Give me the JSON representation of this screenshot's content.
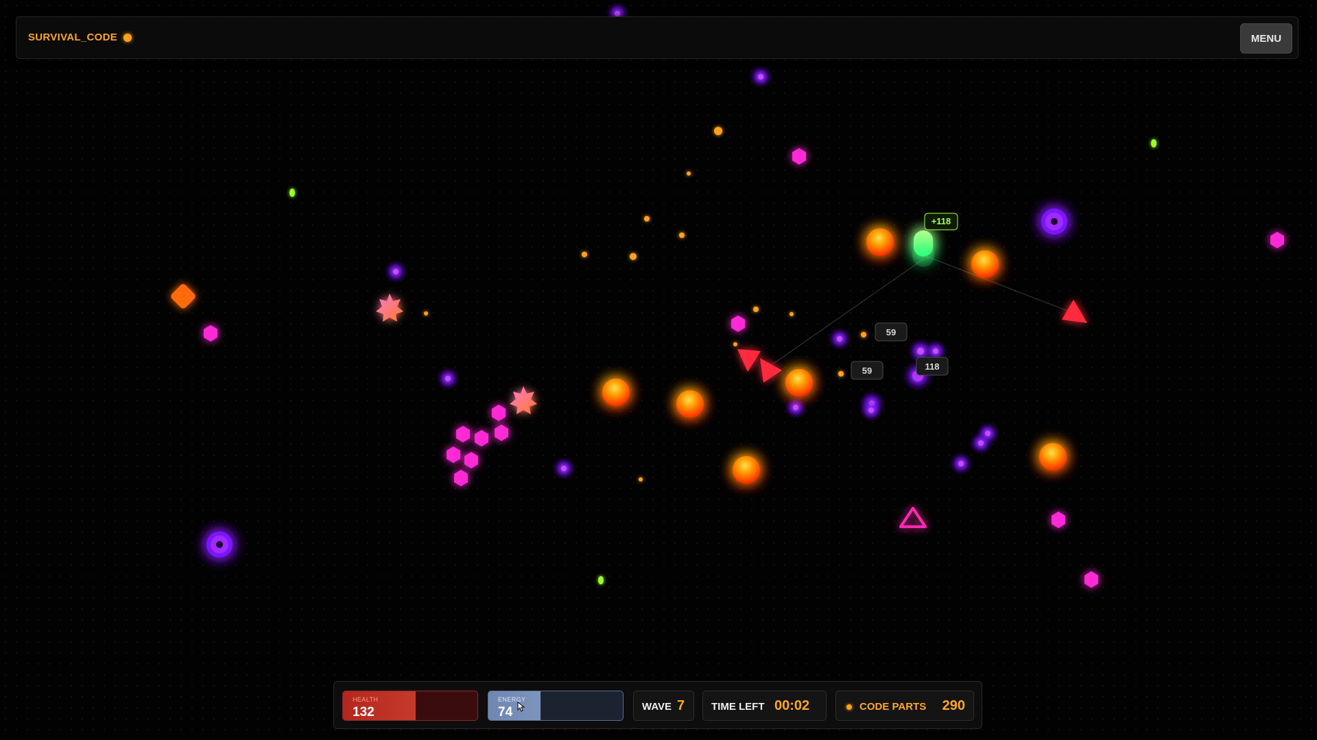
{
  "header": {
    "brand": "SURVIVAL_CODE",
    "menu_label": "MENU"
  },
  "hud": {
    "health": {
      "label": "HEALTH",
      "value": "132",
      "fill_fraction": 0.54
    },
    "energy": {
      "label": "ENERGY",
      "value": "74",
      "fill_fraction": 0.39
    },
    "wave": {
      "label": "WAVE",
      "value": "7"
    },
    "time_left": {
      "label": "TIME LEFT",
      "value": "00:02"
    },
    "code_parts": {
      "label": "CODE PARTS",
      "value": "290"
    }
  },
  "floating_labels": {
    "pickup_gain": "+118",
    "enemy_hp_a": "59",
    "enemy_hp_b": "59",
    "enemy_hp_c": "118"
  },
  "colors": {
    "accent": "#ffa726",
    "player": "#7dff7a",
    "enemy_magenta": "#ff2bd6",
    "enemy_red": "#ff2a3c",
    "enemy_orange": "#ff6a00",
    "enemy_violet": "#8a1cff",
    "health": "#b3261e",
    "energy": "#6e86b0"
  },
  "icons": {
    "player": "player-capsule-icon",
    "code_part": "code-part-dot-icon",
    "fireball": "fireball-enemy-icon",
    "hexagon": "hexagon-enemy-icon",
    "triangle": "triangle-enemy-icon",
    "portal": "portal-enemy-icon",
    "spiky": "spiky-enemy-icon"
  }
}
